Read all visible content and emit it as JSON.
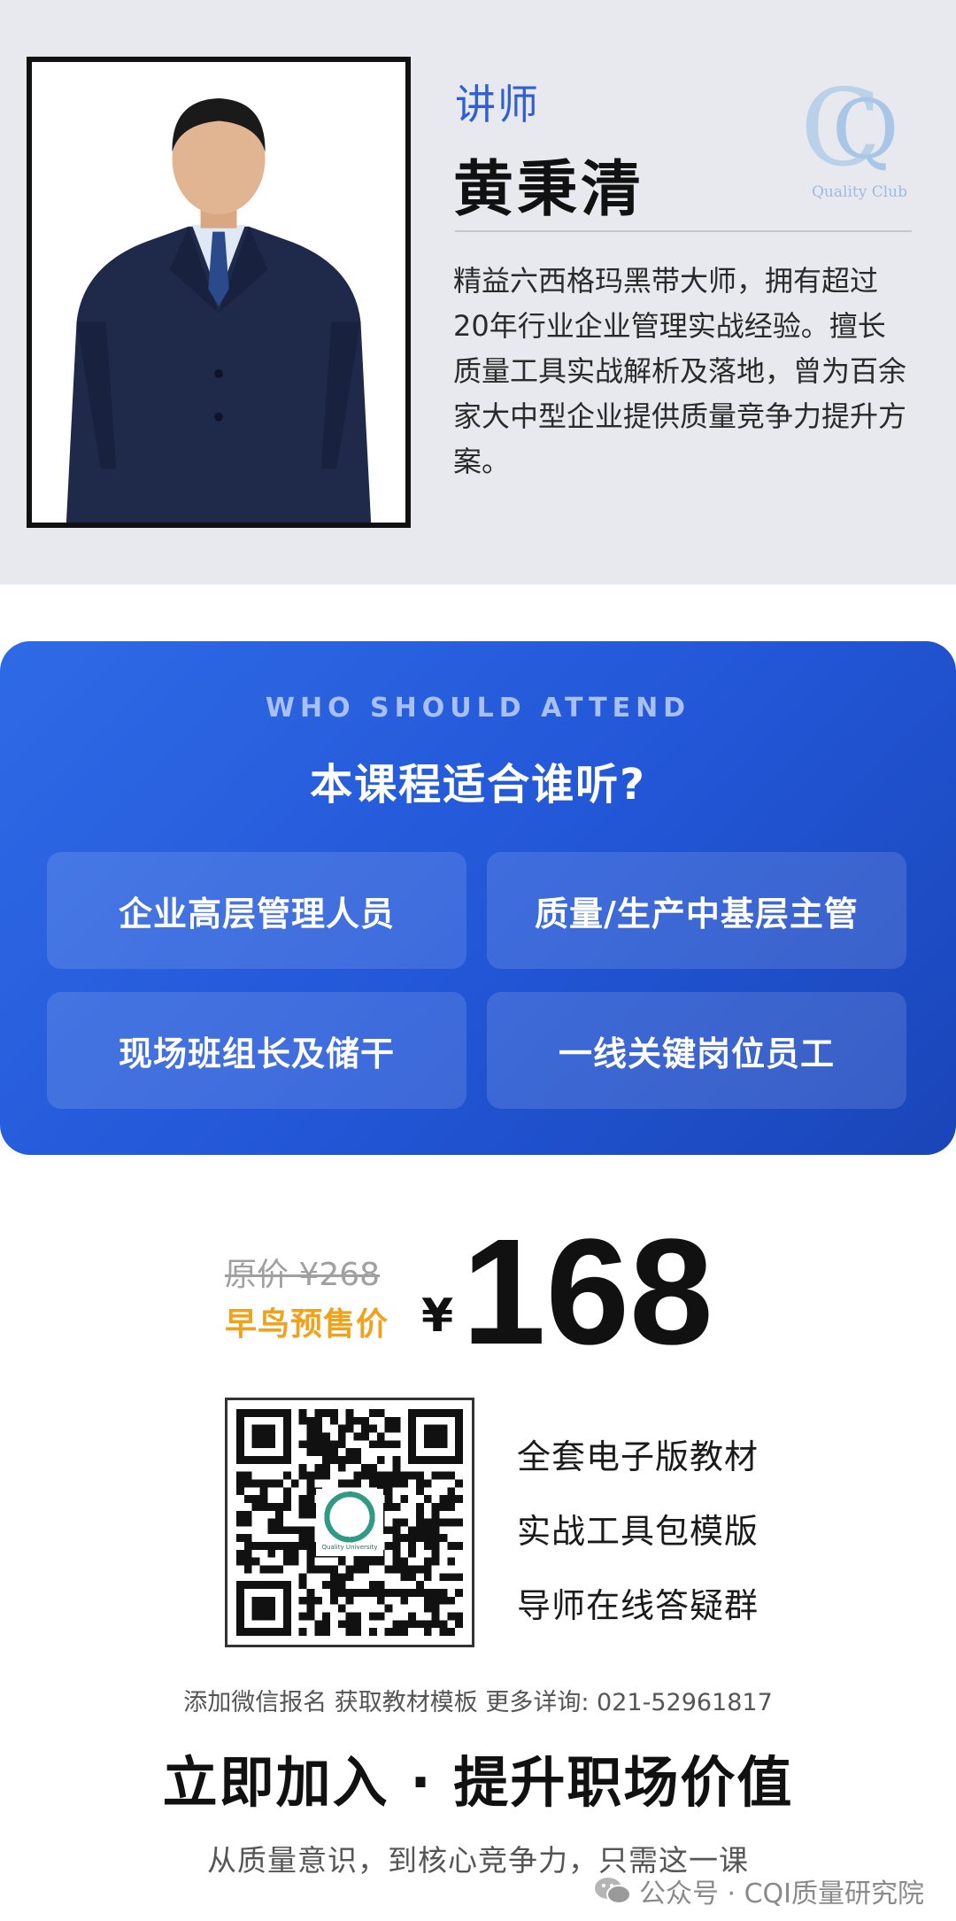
{
  "instructor": {
    "role": "讲师",
    "name": "黄秉清",
    "logo_text": "Quality Club",
    "bio": "精益六西格玛黑带大师，拥有超过20年行业企业管理实战经验。擅长质量工具实战解析及落地，曾为百余家大中型企业提供质量竞争力提升方案。"
  },
  "audience": {
    "kicker": "WHO SHOULD ATTEND",
    "title": "本课程适合谁听?",
    "cards": [
      {
        "label": "企业高层管理人员"
      },
      {
        "label": "质量/生产中基层主管"
      },
      {
        "label": "现场班组长及储干"
      },
      {
        "label": "一线关键岗位员工"
      }
    ]
  },
  "pricing": {
    "original_price": "原价 ¥268",
    "early_bird_label": "早鸟预售价",
    "currency": "¥",
    "price": "168",
    "qr_center_label": "Quality University",
    "benefits": [
      "全套电子版教材",
      "实战工具包模版",
      "导师在线答疑群"
    ],
    "contact": "添加微信报名 获取教材模板  更多详询: 021-52961817",
    "cta": "立即加入 · 提升职场价值",
    "tagline": "从质量意识，到核心竞争力，只需这一课"
  },
  "watermark": {
    "text": "公众号 · CQI质量研究院"
  },
  "colors": {
    "brand_blue": "#2f5fd0",
    "panel_gradient_start": "#2f6ae6",
    "panel_gradient_end": "#1a45b8",
    "early_bird_orange": "#f0a21c"
  }
}
